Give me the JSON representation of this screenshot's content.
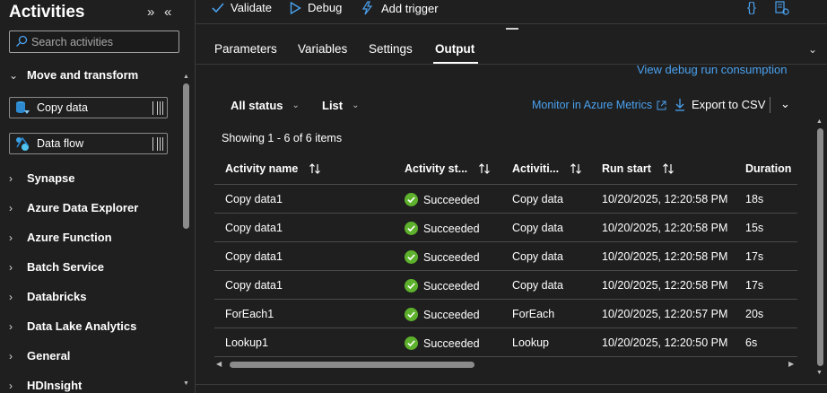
{
  "activities": {
    "title": "Activities",
    "search_placeholder": "Search activities",
    "open_section": "Move and transform",
    "tiles": [
      {
        "label": "Copy data"
      },
      {
        "label": "Data flow"
      }
    ],
    "sections": [
      "Synapse",
      "Azure Data Explorer",
      "Azure Function",
      "Batch Service",
      "Databricks",
      "Data Lake Analytics",
      "General",
      "HDInsight"
    ]
  },
  "toolbar": {
    "validate": "Validate",
    "debug": "Debug",
    "add_trigger": "Add trigger",
    "code_icon": "{}"
  },
  "tabs": [
    "Parameters",
    "Variables",
    "Settings",
    "Output"
  ],
  "output": {
    "debug_link": "View debug run consumption",
    "status_filter": "All status",
    "view_filter": "List",
    "monitor_link": "Monitor in Azure Metrics",
    "export": "Export to CSV",
    "showing": "Showing 1 - 6 of 6 items",
    "columns": [
      "Activity name",
      "Activity st...",
      "Activiti...",
      "Run start",
      "Duration"
    ],
    "rows": [
      {
        "name": "Copy data1",
        "status": "Succeeded",
        "type": "Copy data",
        "start": "10/20/2025, 12:20:58 PM",
        "duration": "18s"
      },
      {
        "name": "Copy data1",
        "status": "Succeeded",
        "type": "Copy data",
        "start": "10/20/2025, 12:20:58 PM",
        "duration": "15s"
      },
      {
        "name": "Copy data1",
        "status": "Succeeded",
        "type": "Copy data",
        "start": "10/20/2025, 12:20:58 PM",
        "duration": "17s"
      },
      {
        "name": "Copy data1",
        "status": "Succeeded",
        "type": "Copy data",
        "start": "10/20/2025, 12:20:58 PM",
        "duration": "17s"
      },
      {
        "name": "ForEach1",
        "status": "Succeeded",
        "type": "ForEach",
        "start": "10/20/2025, 12:20:57 PM",
        "duration": "20s"
      },
      {
        "name": "Lookup1",
        "status": "Succeeded",
        "type": "Lookup",
        "start": "10/20/2025, 12:20:50 PM",
        "duration": "6s"
      }
    ]
  },
  "colors": {
    "accent": "#4aa2f0",
    "success": "#5db12c",
    "background": "#1f1f1f"
  }
}
